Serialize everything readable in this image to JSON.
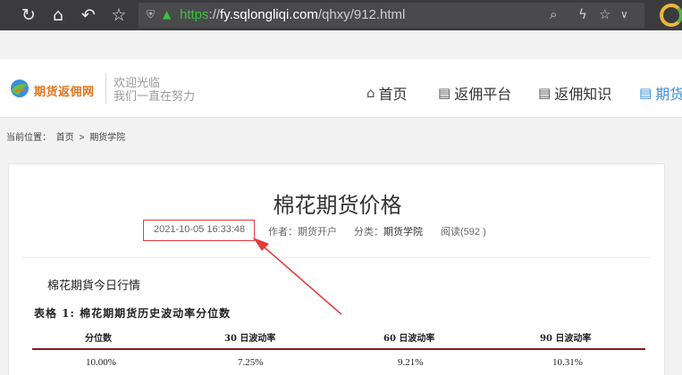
{
  "browser": {
    "url_protocol": "https",
    "url_sep": "://",
    "url_host": "fy.sqlongliqi.com",
    "url_path": "/qhxy/912.html"
  },
  "site": {
    "logo_text": "期货返佣网",
    "slogan_1": "欢迎光临",
    "slogan_2": "我们一直在努力",
    "nav": [
      {
        "label": "首页",
        "icon": "home-icon"
      },
      {
        "label": "返佣平台",
        "icon": "book-icon"
      },
      {
        "label": "返佣知识",
        "icon": "book-icon"
      },
      {
        "label": "期货",
        "icon": "book-icon"
      }
    ]
  },
  "breadcrumb": {
    "prefix": "当前位置：",
    "home": "首页",
    "sep": ">",
    "current": "期货学院"
  },
  "article": {
    "title": "棉花期货价格",
    "date": "2021-10-05 16:33:48",
    "author_label": "作者：",
    "author": "期货开户",
    "category_label": "分类：",
    "category": "期货学院",
    "views": "阅读(592 )",
    "section_heading": "棉花期貨今日行情",
    "table_caption": "表格 1: 棉花期期货历史波动率分位数",
    "table_headers": [
      "分位数",
      "30 日波动率",
      "60 日波动率",
      "90 日波动率"
    ],
    "table_row_1": [
      "10.00%",
      "7.25%",
      "9.21%",
      "10.31%"
    ]
  },
  "colors": {
    "annotation_red": "#e33c3c",
    "nav_active": "#3a8fd6",
    "table_rule": "#8b1a1a"
  }
}
